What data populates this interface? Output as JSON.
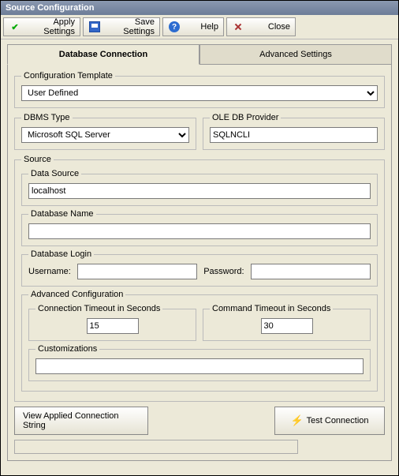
{
  "window": {
    "title": "Source Configuration"
  },
  "toolbar": {
    "apply": "Apply Settings",
    "save": "Save Settings",
    "help": "Help",
    "close": "Close"
  },
  "tabs": {
    "db": "Database Connection",
    "adv": "Advanced Settings"
  },
  "configTemplate": {
    "legend": "Configuration Template",
    "value": "User Defined"
  },
  "dbmsType": {
    "legend": "DBMS Type",
    "value": "Microsoft SQL Server"
  },
  "oleProvider": {
    "legend": "OLE DB Provider",
    "value": "SQLNCLI"
  },
  "source": {
    "legend": "Source",
    "dataSource": {
      "legend": "Data Source",
      "value": "localhost"
    },
    "dbName": {
      "legend": "Database Name",
      "value": ""
    },
    "dbLogin": {
      "legend": "Database Login",
      "usernameLabel": "Username:",
      "usernameValue": "",
      "passwordLabel": "Password:",
      "passwordValue": ""
    },
    "advanced": {
      "legend": "Advanced Configuration",
      "connTimeout": {
        "legend": "Connection Timeout in Seconds",
        "value": "15"
      },
      "cmdTimeout": {
        "legend": "Command Timeout in Seconds",
        "value": "30"
      },
      "customizations": {
        "legend": "Customizations",
        "value": ""
      }
    }
  },
  "buttons": {
    "viewConn": "View Applied Connection String",
    "test": "Test Connection"
  }
}
